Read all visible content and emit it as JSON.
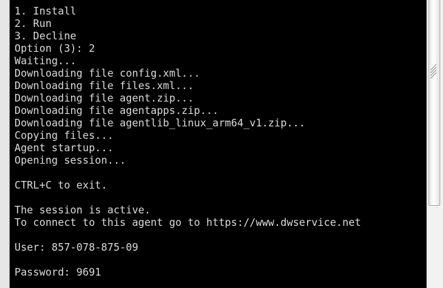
{
  "terminal": {
    "lines": [
      "1. Install",
      "2. Run",
      "3. Decline",
      "Option (3): 2",
      "Waiting...",
      "Downloading file config.xml...",
      "Downloading file files.xml...",
      "Downloading file agent.zip...",
      "Downloading file agentapps.zip...",
      "Downloading file agentlib_linux_arm64_v1.zip...",
      "Copying files...",
      "Agent startup...",
      "Opening session...",
      "",
      "CTRL+C to exit.",
      "",
      "The session is active.",
      "To connect to this agent go to https://www.dwservice.net",
      "",
      "User: 857-078-875-09",
      "",
      "Password: 9691"
    ]
  },
  "colors": {
    "terminal_bg": "#000000",
    "terminal_fg": "#dcdcdc"
  },
  "icons": {
    "scrollbar_grip": "grip-icon"
  }
}
